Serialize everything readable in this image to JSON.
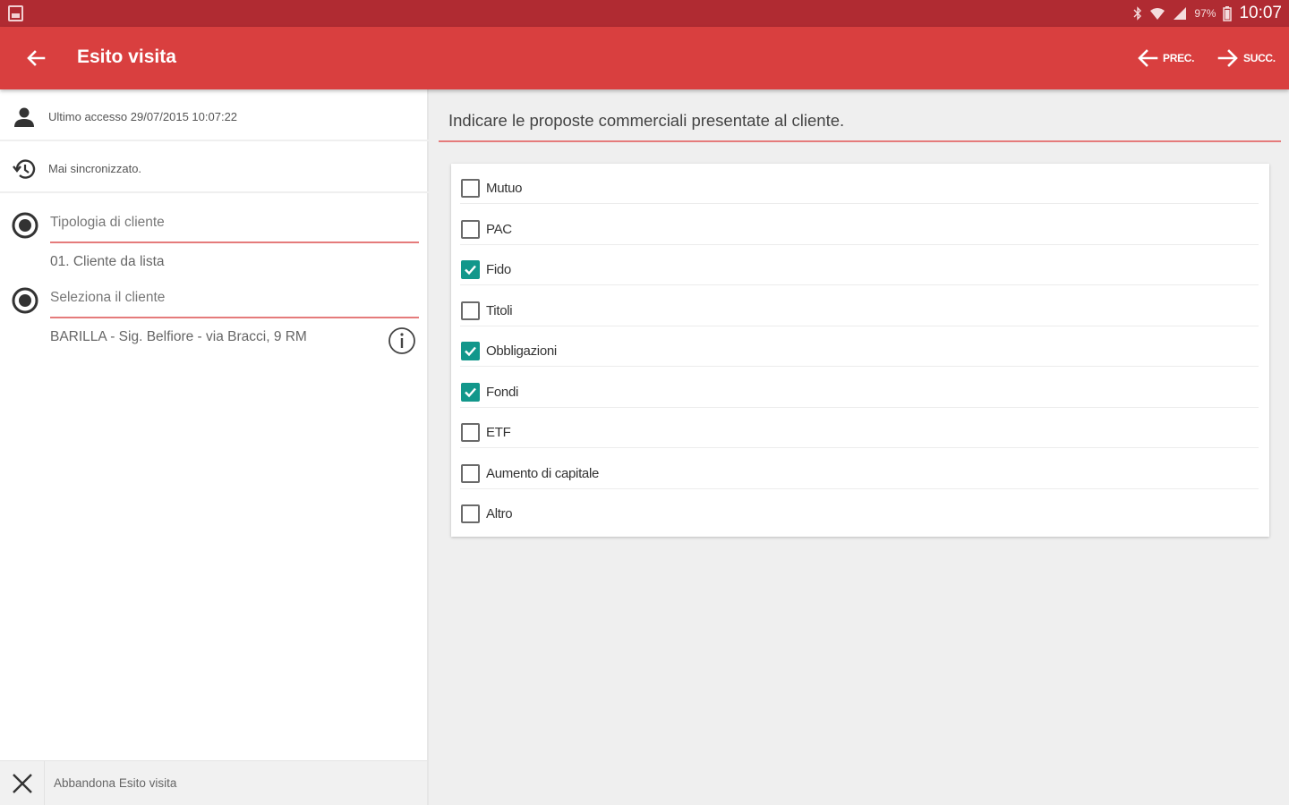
{
  "status_bar": {
    "battery": "97%",
    "time": "10:07"
  },
  "app_bar": {
    "title": "Esito visita",
    "prev_label": "PREC.",
    "next_label": "SUCC."
  },
  "left_panel": {
    "last_access": "Ultimo accesso 29/07/2015 10:07:22",
    "sync_status": "Mai sincronizzato.",
    "fields": [
      {
        "label": "Tipologia di cliente",
        "value": "01. Cliente da lista"
      },
      {
        "label": "Seleziona il cliente",
        "value": "BARILLA - Sig. Belfiore - via Bracci, 9 RM"
      }
    ],
    "abandon_label": "Abbandona Esito visita"
  },
  "main": {
    "prompt": "Indicare le proposte commerciali presentate al cliente.",
    "options": [
      {
        "label": "Mutuo",
        "checked": false
      },
      {
        "label": "PAC",
        "checked": false
      },
      {
        "label": "Fido",
        "checked": true
      },
      {
        "label": "Titoli",
        "checked": false
      },
      {
        "label": "Obbligazioni",
        "checked": true
      },
      {
        "label": "Fondi",
        "checked": true
      },
      {
        "label": "ETF",
        "checked": false
      },
      {
        "label": "Aumento di capitale",
        "checked": false
      },
      {
        "label": "Altro",
        "checked": false
      }
    ]
  },
  "colors": {
    "status_bar": "#b02b32",
    "app_bar": "#d93f3f",
    "accent_line": "#e57b7b",
    "checkbox_checked": "#12978b"
  }
}
